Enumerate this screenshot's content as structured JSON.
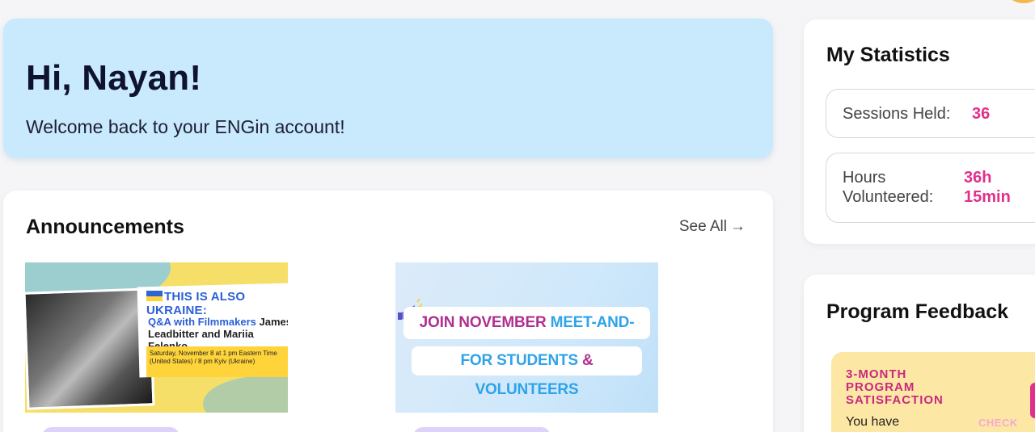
{
  "welcome": {
    "greeting": "Hi, Nayan!",
    "subtitle": "Welcome back to your ENGin account!"
  },
  "announcements": {
    "title": "Announcements",
    "see_all": "See All",
    "see_all_arrow": "→",
    "items": [
      {
        "headline": "THIS IS ALSO UKRAINE:",
        "sub_highlight": "Q&A with Filmmakers",
        "sub_rest": " James Leadbitter and Mariia Felenko",
        "date": "Saturday, November 8 at 1 pm Eastern Time (United States) / 8 pm Kyiv (Ukraine)"
      },
      {
        "line1_a": "JOIN NOVEMBER ",
        "line1_b": "MEET-AND-TALKS",
        "line2_a": "FOR STUDENTS ",
        "line2_amp": "& ",
        "line2_b": "VOLUNTEERS"
      }
    ]
  },
  "stats": {
    "title": "My Statistics",
    "sessions_label": "Sessions Held:",
    "sessions_value": "36",
    "hours_label": "Hours Volunteered:",
    "hours_value": "36h 15min"
  },
  "feedback": {
    "title": "Program Feedback",
    "card_heading": "3-MONTH PROGRAM SATISFACTION",
    "card_body": "You have",
    "card_action": "CHECK"
  },
  "colors": {
    "welcome_bg": "#c9e9fd",
    "accent_pink": "#e0308b",
    "feedback_card": "#fde7a5",
    "chip": "#ddd2fb"
  }
}
